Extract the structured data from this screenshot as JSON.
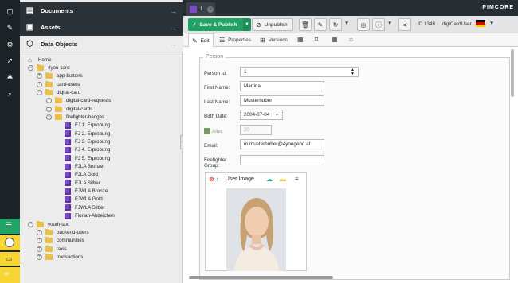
{
  "left_nav": {
    "icons": [
      "file-icon",
      "wrench-icon",
      "gear-icon",
      "rocket-icon",
      "bug-icon",
      "search-icon"
    ],
    "bottom_icons": [
      "notification-icon",
      "user-icon",
      "inbox-icon",
      "link-icon"
    ]
  },
  "sidebar": {
    "sections": [
      {
        "label": "Documents",
        "icon": "document-icon"
      },
      {
        "label": "Assets",
        "icon": "image-icon"
      },
      {
        "label": "Data Objects",
        "icon": "cube-icon"
      }
    ],
    "tree": [
      {
        "label": "Home",
        "type": "home",
        "level": 0,
        "toggle": ""
      },
      {
        "label": "4you-card",
        "type": "folder",
        "level": 0,
        "toggle": "-"
      },
      {
        "label": "app-buttons",
        "type": "folder",
        "level": 1,
        "toggle": "+"
      },
      {
        "label": "card-users",
        "type": "folder",
        "level": 1,
        "toggle": "+"
      },
      {
        "label": "digital-card",
        "type": "folder",
        "level": 1,
        "toggle": "-"
      },
      {
        "label": "digital-card-requests",
        "type": "folder",
        "level": 2,
        "toggle": "+"
      },
      {
        "label": "digital-cards",
        "type": "folder",
        "level": 2,
        "toggle": "+"
      },
      {
        "label": "firefighter-badges",
        "type": "folder",
        "level": 2,
        "toggle": "-"
      },
      {
        "label": "FJ 1. Erprobung",
        "type": "object",
        "level": 3,
        "toggle": ""
      },
      {
        "label": "FJ 2. Erprobung",
        "type": "object",
        "level": 3,
        "toggle": ""
      },
      {
        "label": "FJ 3. Erprobung",
        "type": "object",
        "level": 3,
        "toggle": ""
      },
      {
        "label": "FJ 4. Erprobung",
        "type": "object",
        "level": 3,
        "toggle": ""
      },
      {
        "label": "FJ 5. Erprobung",
        "type": "object",
        "level": 3,
        "toggle": ""
      },
      {
        "label": "FJLA Bronze",
        "type": "object",
        "level": 3,
        "toggle": ""
      },
      {
        "label": "FJLA Gold",
        "type": "object",
        "level": 3,
        "toggle": ""
      },
      {
        "label": "FJLA Silber",
        "type": "object",
        "level": 3,
        "toggle": ""
      },
      {
        "label": "FJWLA Bronze",
        "type": "object",
        "level": 3,
        "toggle": ""
      },
      {
        "label": "FJWLA Gold",
        "type": "object",
        "level": 3,
        "toggle": ""
      },
      {
        "label": "FJWLA Silber",
        "type": "object",
        "level": 3,
        "toggle": ""
      },
      {
        "label": "Florian-Abzeichen",
        "type": "object",
        "level": 3,
        "toggle": ""
      },
      {
        "label": "youth-taxi",
        "type": "folder",
        "level": 0,
        "toggle": "-"
      },
      {
        "label": "backend-users",
        "type": "folder",
        "level": 1,
        "toggle": "+"
      },
      {
        "label": "communities",
        "type": "folder",
        "level": 1,
        "toggle": "+"
      },
      {
        "label": "taxis",
        "type": "folder",
        "level": 1,
        "toggle": "+"
      },
      {
        "label": "transactions",
        "type": "folder",
        "level": 1,
        "toggle": "+"
      }
    ]
  },
  "topbar": {
    "tab_label": "1",
    "logo": "PIMCORE"
  },
  "toolbar": {
    "save_publish": "Save & Publish",
    "unpublish": "Unpublish",
    "id_text": "ID 1348",
    "class_name": "digiCardUser",
    "language": "de"
  },
  "subtabs": {
    "edit": "Edit",
    "properties": "Properties",
    "versions": "Versions"
  },
  "form": {
    "legend": "Person",
    "person_id_label": "Person Id:",
    "person_id_value": "1",
    "first_name_label": "First Name:",
    "first_name_value": "Martina",
    "last_name_label": "Last Name:",
    "last_name_value": "Musterhuber",
    "birth_date_label": "Birth Date:",
    "birth_date_value": "2004-07-04",
    "age_label": "Alter:",
    "age_value": "20",
    "email_label": "Email:",
    "email_value": "m.musterhuber@4yougend.at",
    "group_label": "Firefighter Group:",
    "group_value": "",
    "image_title": "User Image"
  },
  "colors": {
    "accent_green": "#21a366",
    "nav_dark": "#1c2327",
    "folder": "#e9bf4a",
    "object": "#7a4bc4",
    "yellow": "#f7d633"
  }
}
